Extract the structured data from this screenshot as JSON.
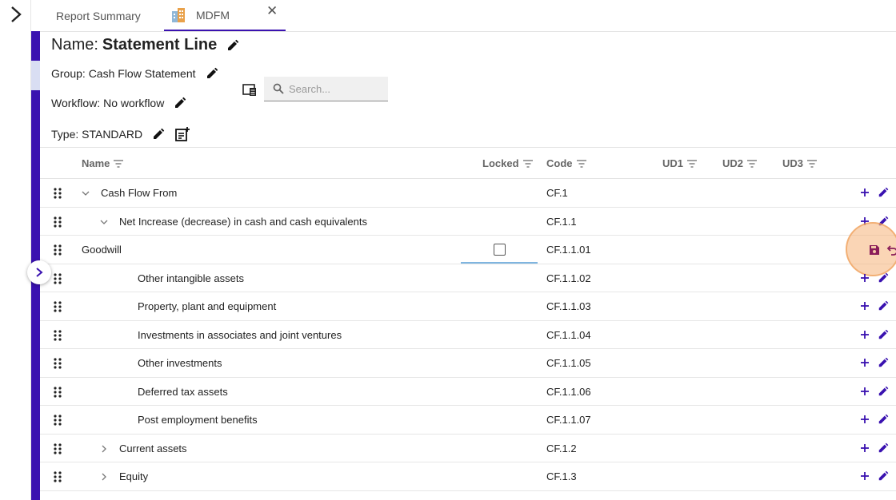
{
  "tabs": [
    {
      "label": "Report Summary",
      "active": false
    },
    {
      "label": "MDFM",
      "active": true,
      "closable": true
    }
  ],
  "header": {
    "name_prefix": "Name:",
    "name_value": "Statement Line",
    "group": "Group: Cash Flow Statement",
    "workflow": "Workflow: No workflow",
    "type": "Type: STANDARD"
  },
  "search": {
    "placeholder": "Search...",
    "value": ""
  },
  "columns": {
    "name": "Name",
    "locked": "Locked",
    "code": "Code",
    "ud1": "UD1",
    "ud2": "UD2",
    "ud3": "UD3"
  },
  "rows": [
    {
      "name": "Cash Flow From",
      "code": "CF.1",
      "level": 0,
      "expander": "expanded"
    },
    {
      "name": "Net Increase (decrease) in cash and cash equivalents",
      "code": "CF.1.1",
      "level": 1,
      "expander": "expanded"
    },
    {
      "name": "Goodwill",
      "code": "CF.1.1.01",
      "level": 2,
      "editing": true,
      "locked": false
    },
    {
      "name": "Other intangible assets",
      "code": "CF.1.1.02",
      "level": 2
    },
    {
      "name": "Property, plant and equipment",
      "code": "CF.1.1.03",
      "level": 2
    },
    {
      "name": "Investments in associates and joint ventures",
      "code": "CF.1.1.04",
      "level": 2
    },
    {
      "name": "Other investments",
      "code": "CF.1.1.05",
      "level": 2
    },
    {
      "name": "Deferred tax assets",
      "code": "CF.1.1.06",
      "level": 2
    },
    {
      "name": "Post employment benefits",
      "code": "CF.1.1.07",
      "level": 2
    },
    {
      "name": "Current assets",
      "code": "CF.1.2",
      "level": 1,
      "expander": "collapsed"
    },
    {
      "name": "Equity",
      "code": "CF.1.3",
      "level": 1,
      "expander": "collapsed"
    }
  ],
  "colors": {
    "accent": "#3a12b0",
    "row_action": "#3a12b0",
    "save_icon": "#8a1d5a",
    "highlight": "#f5b278"
  }
}
